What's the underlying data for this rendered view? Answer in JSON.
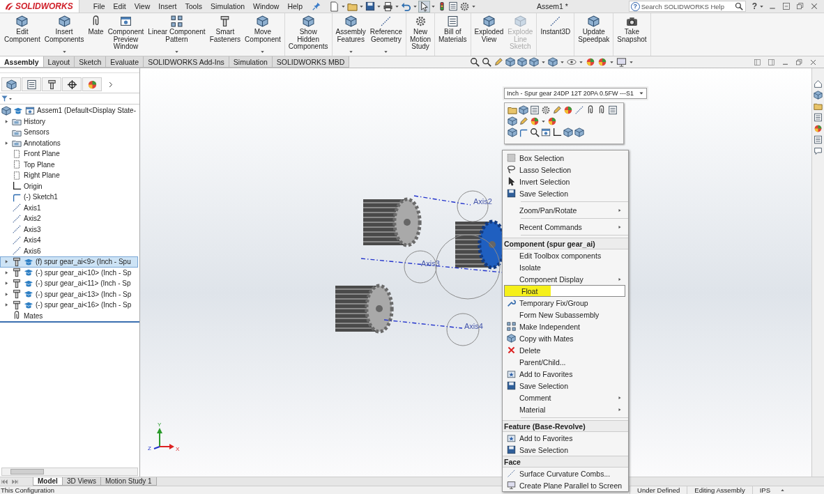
{
  "app": {
    "logo": "SOLIDWORKS",
    "menus": [
      "File",
      "Edit",
      "View",
      "Insert",
      "Tools",
      "Simulation",
      "Window",
      "Help"
    ],
    "title": "Assem1 *",
    "search": {
      "placeholder": "Search SOLIDWORKS Help",
      "badge": "?"
    },
    "help": "?"
  },
  "ribbon": [
    {
      "buttons": [
        {
          "label": "Edit\nComponent",
          "dropdown": false,
          "disabled": false
        },
        {
          "label": "Insert\nComponents",
          "dropdown": true,
          "disabled": false
        },
        {
          "label": "Mate",
          "dropdown": false,
          "disabled": false
        },
        {
          "label": "Component\nPreview\nWindow",
          "dropdown": false,
          "disabled": false
        },
        {
          "label": "Linear Component\nPattern",
          "dropdown": true,
          "disabled": false
        },
        {
          "label": "Smart\nFasteners",
          "dropdown": false,
          "disabled": false
        },
        {
          "label": "Move\nComponent",
          "dropdown": true,
          "disabled": false
        }
      ]
    },
    {
      "buttons": [
        {
          "label": "Show\nHidden\nComponents",
          "dropdown": false,
          "disabled": false
        }
      ]
    },
    {
      "buttons": [
        {
          "label": "Assembly\nFeatures",
          "dropdown": true,
          "disabled": false
        },
        {
          "label": "Reference\nGeometry",
          "dropdown": true,
          "disabled": false
        }
      ]
    },
    {
      "buttons": [
        {
          "label": "New\nMotion\nStudy",
          "dropdown": false,
          "disabled": false
        }
      ]
    },
    {
      "buttons": [
        {
          "label": "Bill of\nMaterials",
          "dropdown": false,
          "disabled": false
        }
      ]
    },
    {
      "buttons": [
        {
          "label": "Exploded\nView",
          "dropdown": false,
          "disabled": false
        },
        {
          "label": "Explode\nLine\nSketch",
          "dropdown": false,
          "disabled": true
        }
      ]
    },
    {
      "buttons": [
        {
          "label": "Instant3D",
          "dropdown": false,
          "disabled": false
        }
      ]
    },
    {
      "buttons": [
        {
          "label": "Update\nSpeedpak",
          "dropdown": false,
          "disabled": false
        }
      ]
    },
    {
      "buttons": [
        {
          "label": "Take\nSnapshot",
          "dropdown": false,
          "disabled": false
        }
      ]
    }
  ],
  "command_tabs": [
    {
      "label": "Assembly",
      "selected": true
    },
    {
      "label": "Layout",
      "selected": false
    },
    {
      "label": "Sketch",
      "selected": false
    },
    {
      "label": "Evaluate",
      "selected": false
    },
    {
      "label": "SOLIDWORKS Add-Ins",
      "selected": false
    },
    {
      "label": "Simulation",
      "selected": false
    },
    {
      "label": "SOLIDWORKS MBD",
      "selected": false
    }
  ],
  "tree": {
    "root": {
      "label": "Assem1 (Default<Display State-",
      "kind": "assembly",
      "selected": false,
      "children": [
        {
          "label": "History",
          "kind": "history",
          "expandable": true,
          "selected": false
        },
        {
          "label": "Sensors",
          "kind": "sensor",
          "expandable": false,
          "selected": false
        },
        {
          "label": "Annotations",
          "kind": "annotation",
          "expandable": true,
          "selected": false
        },
        {
          "label": "Front Plane",
          "kind": "plane",
          "expandable": false,
          "selected": false
        },
        {
          "label": "Top Plane",
          "kind": "plane",
          "expandable": false,
          "selected": false
        },
        {
          "label": "Right Plane",
          "kind": "plane",
          "expandable": false,
          "selected": false
        },
        {
          "label": "Origin",
          "kind": "origin",
          "expandable": false,
          "selected": false
        },
        {
          "label": "(-) Sketch1",
          "kind": "sketch",
          "expandable": false,
          "selected": false
        },
        {
          "label": "Axis1",
          "kind": "axis",
          "expandable": false,
          "selected": false
        },
        {
          "label": "Axis2",
          "kind": "axis",
          "expandable": false,
          "selected": false
        },
        {
          "label": "Axis3",
          "kind": "axis",
          "expandable": false,
          "selected": false
        },
        {
          "label": "Axis4",
          "kind": "axis",
          "expandable": false,
          "selected": false
        },
        {
          "label": "Axis6",
          "kind": "axis",
          "expandable": false,
          "selected": false
        },
        {
          "label": "(f) spur gear_ai<9> (Inch - Spu",
          "kind": "part",
          "expandable": true,
          "selected": true
        },
        {
          "label": "(-) spur gear_ai<10> (Inch - Sp",
          "kind": "part",
          "expandable": true,
          "selected": false
        },
        {
          "label": "(-) spur gear_ai<11> (Inch - Sp",
          "kind": "part",
          "expandable": true,
          "selected": false
        },
        {
          "label": "(-) spur gear_ai<13> (Inch - Sp",
          "kind": "part",
          "expandable": true,
          "selected": false
        },
        {
          "label": "(-) spur gear_ai<16> (Inch - Sp",
          "kind": "part",
          "expandable": true,
          "selected": false
        },
        {
          "label": "Mates",
          "kind": "mates",
          "expandable": false,
          "selected": false
        }
      ]
    }
  },
  "viewport": {
    "axis_labels": [
      "Axis2",
      "Axis3",
      "Axis4"
    ],
    "triad": {
      "x": "X",
      "y": "Y",
      "z": "Z"
    }
  },
  "context_menu": {
    "configuration": "Inch - Spur gear 24DP 12T 20PA 0.5FW ---S1",
    "sections": [
      {
        "items": [
          {
            "kind": "command",
            "label": "Box Selection",
            "selected": false
          },
          {
            "kind": "command",
            "label": "Lasso Selection",
            "selected": false
          },
          {
            "kind": "command",
            "label": "Invert Selection",
            "selected": false
          },
          {
            "kind": "command",
            "label": "Save Selection",
            "selected": false
          },
          {
            "kind": "separator"
          },
          {
            "kind": "submenu",
            "label": "Zoom/Pan/Rotate",
            "selected": false
          },
          {
            "kind": "separator"
          },
          {
            "kind": "submenu",
            "label": "Recent Commands",
            "selected": false
          },
          {
            "kind": "separator"
          }
        ]
      },
      {
        "heading": "Component (spur gear_ai)",
        "items": [
          {
            "kind": "command",
            "label": "Edit Toolbox components",
            "selected": false
          },
          {
            "kind": "command",
            "label": "Isolate",
            "selected": false
          },
          {
            "kind": "submenu",
            "label": "Component Display",
            "selected": false
          },
          {
            "kind": "command",
            "label": "Float",
            "selected": true
          },
          {
            "kind": "command",
            "label": "Temporary Fix/Group",
            "selected": false
          },
          {
            "kind": "command",
            "label": "Form New Subassembly",
            "selected": false
          },
          {
            "kind": "command",
            "label": "Make Independent",
            "selected": false
          },
          {
            "kind": "command",
            "label": "Copy with Mates",
            "selected": false
          },
          {
            "kind": "command",
            "label": "Delete",
            "selected": false
          },
          {
            "kind": "command",
            "label": "Parent/Child...",
            "selected": false
          },
          {
            "kind": "command",
            "label": "Add to Favorites",
            "selected": false
          },
          {
            "kind": "command",
            "label": "Save Selection",
            "selected": false
          },
          {
            "kind": "submenu",
            "label": "Comment",
            "selected": false
          },
          {
            "kind": "submenu",
            "label": "Material",
            "selected": false
          },
          {
            "kind": "separator"
          }
        ]
      },
      {
        "heading": "Feature (Base-Revolve)",
        "items": [
          {
            "kind": "command",
            "label": "Add to Favorites",
            "selected": false
          },
          {
            "kind": "command",
            "label": "Save Selection",
            "selected": false
          }
        ]
      },
      {
        "heading": "Face",
        "items": [
          {
            "kind": "command",
            "label": "Surface Curvature Combs...",
            "selected": false
          },
          {
            "kind": "command",
            "label": "Create Plane Parallel to Screen",
            "selected": false
          }
        ]
      }
    ]
  },
  "bottom_tabs": [
    {
      "label": "Model",
      "selected": true
    },
    {
      "label": "3D Views",
      "selected": false
    },
    {
      "label": "Motion Study 1",
      "selected": false
    }
  ],
  "status_bar": {
    "left": "This Configuration",
    "items": [
      "Under Defined",
      "Editing Assembly",
      "IPS"
    ]
  }
}
